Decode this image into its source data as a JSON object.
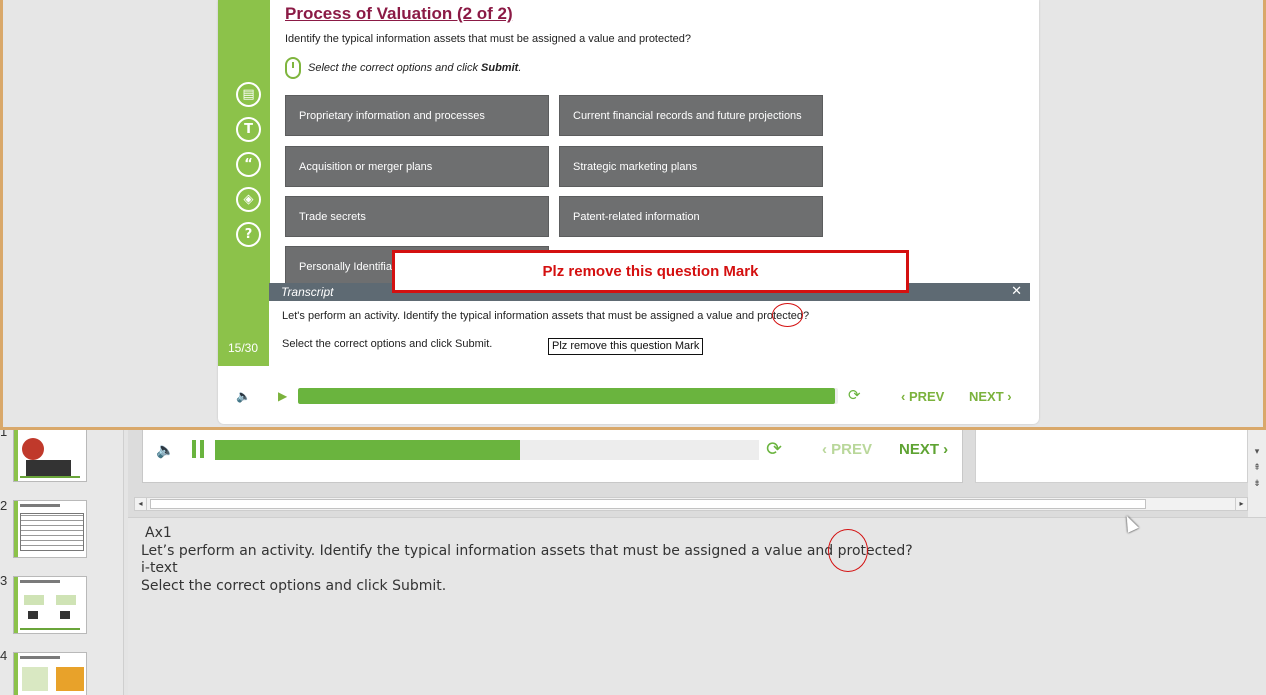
{
  "course": {
    "title": "Process of Valuation (2 of 2)",
    "question": "Identify the typical information assets that must be assigned a value and protected?",
    "instruction_prefix": "Select the correct options and click ",
    "instruction_emphasis": "Submit",
    "instruction_suffix": ".",
    "page_counter": "15/30",
    "rail_icons": [
      "document-icon",
      "text-icon",
      "quote-icon",
      "layers-icon",
      "help-icon"
    ],
    "rail_glyphs": [
      "▤",
      "T",
      "“",
      "◈",
      "?"
    ],
    "options": [
      "Proprietary information and processes",
      "Current financial records and future projections",
      "Acquisition or merger plans",
      "Strategic marketing plans",
      "Trade secrets",
      "Patent-related information",
      "Personally Identifiab"
    ]
  },
  "annotation_large": "Plz remove this question Mark",
  "annotation_small": "Plz remove this question Mark",
  "transcript": {
    "header": "Transcript",
    "close_glyph": "✕",
    "line1": "Let's perform an activity. Identify the typical information assets that must be assigned a value and protected?",
    "line2": "Select the correct options and click Submit."
  },
  "player": {
    "prev_label": "‹ PREV",
    "next_label": "NEXT ›",
    "progress": 0.995,
    "volume_glyph": "🔈",
    "play_glyph": "▶",
    "reload_glyph": "⟳"
  },
  "bg_player": {
    "prev_label": "‹ PREV",
    "next_label": "NEXT ›",
    "progress": 0.56,
    "volume_glyph": "🔈",
    "reload_glyph": "⟳"
  },
  "thumbnails": {
    "numbers": [
      "1",
      "2",
      "3",
      "4"
    ]
  },
  "notes": {
    "lines": [
      "Ax1",
      "Let’s perform an activity. Identify the typical information assets that must be assigned a value and protected?",
      "i-text",
      "Select the correct options and click Submit."
    ]
  },
  "scroll": {
    "left_glyph": "◂",
    "right_glyph": "▸",
    "down_glyph": "▾",
    "prev_slide_glyph": "⇞",
    "next_slide_glyph": "⇟"
  },
  "colors": {
    "accent_green": "#8cc24a",
    "title_maroon": "#8b1a45",
    "option_gray": "#6e6f70",
    "annotation_red": "#d41010"
  }
}
